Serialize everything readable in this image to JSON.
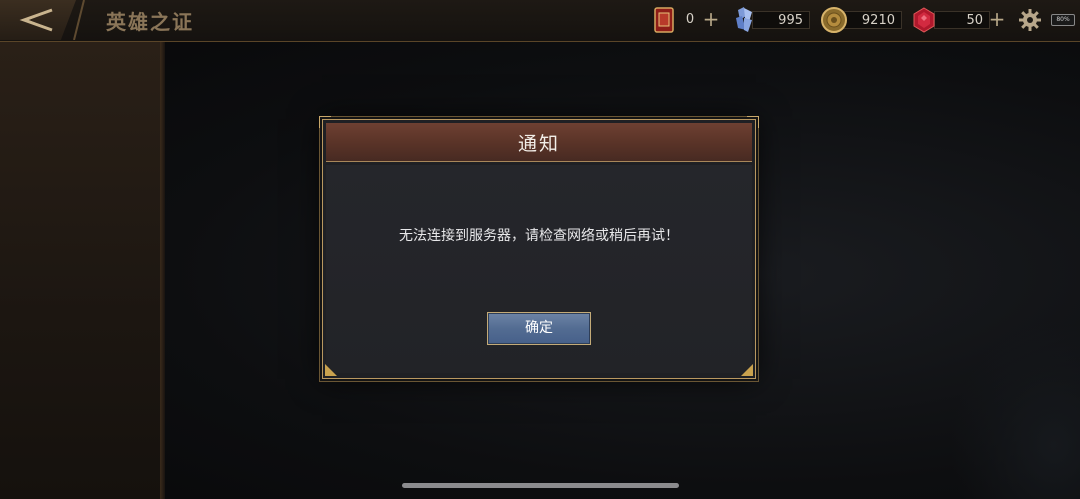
{
  "header": {
    "title": "英雄之证",
    "back_icon": "back-chevron-icon"
  },
  "resources": [
    {
      "name": "card",
      "icon": "red-card-icon",
      "value": "0",
      "has_plus": true
    },
    {
      "name": "crystal",
      "icon": "blue-crystal-icon",
      "value": "995",
      "has_plus": false
    },
    {
      "name": "coin",
      "icon": "gold-coin-icon",
      "value": "9210",
      "has_plus": false
    },
    {
      "name": "gem",
      "icon": "red-gem-icon",
      "value": "50",
      "has_plus": true
    }
  ],
  "plus_label": "+",
  "status": {
    "battery": "80%"
  },
  "modal": {
    "title": "通知",
    "message": "无法连接到服务器，请检查网络或稍后再试！",
    "ok_label": "确定"
  },
  "colors": {
    "accent_gold": "#b99860",
    "header_brown": "#5b3428",
    "button_blue": "#536c92"
  }
}
